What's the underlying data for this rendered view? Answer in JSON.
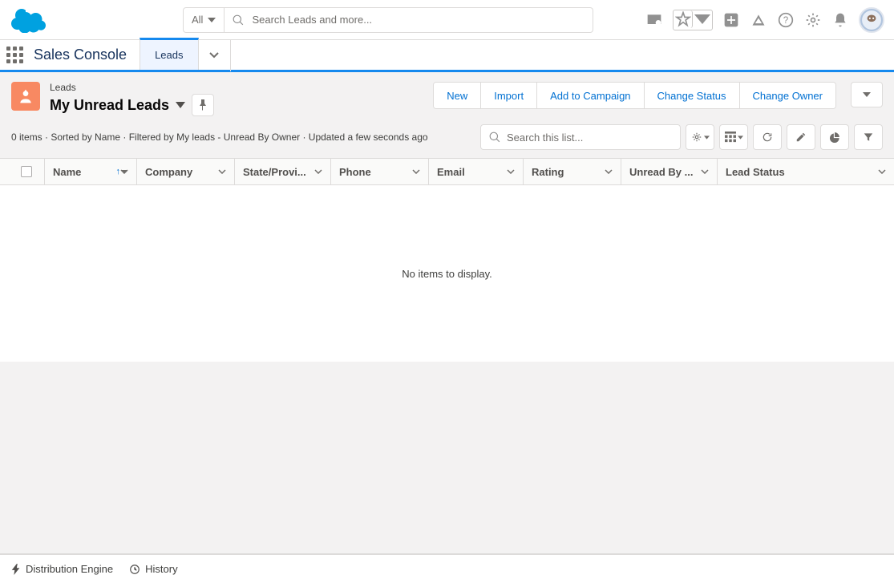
{
  "global": {
    "search_scope": "All",
    "search_placeholder": "Search Leads and more..."
  },
  "app": {
    "name": "Sales Console",
    "workspace_tab": "Leads"
  },
  "list": {
    "object_label": "Leads",
    "view_name": "My Unread Leads",
    "status": "0 items · Sorted by Name · Filtered by My leads - Unread By Owner · Updated a few seconds ago",
    "search_placeholder": "Search this list...",
    "empty_message": "No items to display."
  },
  "actions": {
    "new": "New",
    "import": "Import",
    "add_campaign": "Add to Campaign",
    "change_status": "Change Status",
    "change_owner": "Change Owner"
  },
  "columns": {
    "name": "Name",
    "company": "Company",
    "state": "State/Provi...",
    "phone": "Phone",
    "email": "Email",
    "rating": "Rating",
    "unread": "Unread By ...",
    "status": "Lead Status"
  },
  "footer": {
    "de": "Distribution Engine",
    "history": "History"
  }
}
